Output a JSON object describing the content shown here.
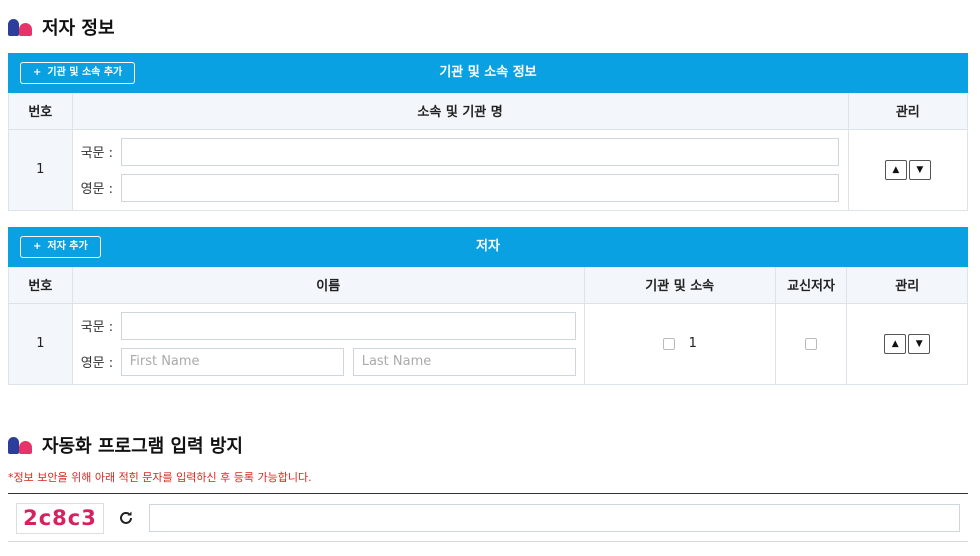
{
  "author_section": {
    "title": "저자 정보"
  },
  "affiliation_panel": {
    "title": "기관 및 소속 정보",
    "add_button": "기관 및 소속 추가",
    "columns": [
      "번호",
      "소속 및 기관 명",
      "관리"
    ],
    "rows": [
      {
        "number": "1",
        "korean_label": "국문 :",
        "english_label": "영문 :",
        "korean_value": "",
        "english_value": ""
      }
    ]
  },
  "author_panel": {
    "title": "저자",
    "add_button": "저자 추가",
    "columns": [
      "번호",
      "이름",
      "기관 및 소속",
      "교신저자",
      "관리"
    ],
    "rows": [
      {
        "number": "1",
        "korean_label": "국문 :",
        "english_label": "영문 :",
        "korean_value": "",
        "first_name_placeholder": "First Name",
        "last_name_placeholder": "Last Name",
        "affiliation_value": "1"
      }
    ]
  },
  "captcha_section": {
    "title": "자동화 프로그램 입력 방지",
    "notice": "*정보 보안을 위해 아래 적힌 문자를 입력하신 후 등록 가능합니다.",
    "code": "2c8c3",
    "input_value": ""
  },
  "colors": {
    "header_bg": "#0aa1e2",
    "captcha_text": "#d6215f",
    "notice": "#d8281f"
  },
  "icons": {
    "move_up": "triangle-up",
    "move_down": "triangle-down",
    "refresh": "refresh-icon",
    "add": "plus"
  }
}
